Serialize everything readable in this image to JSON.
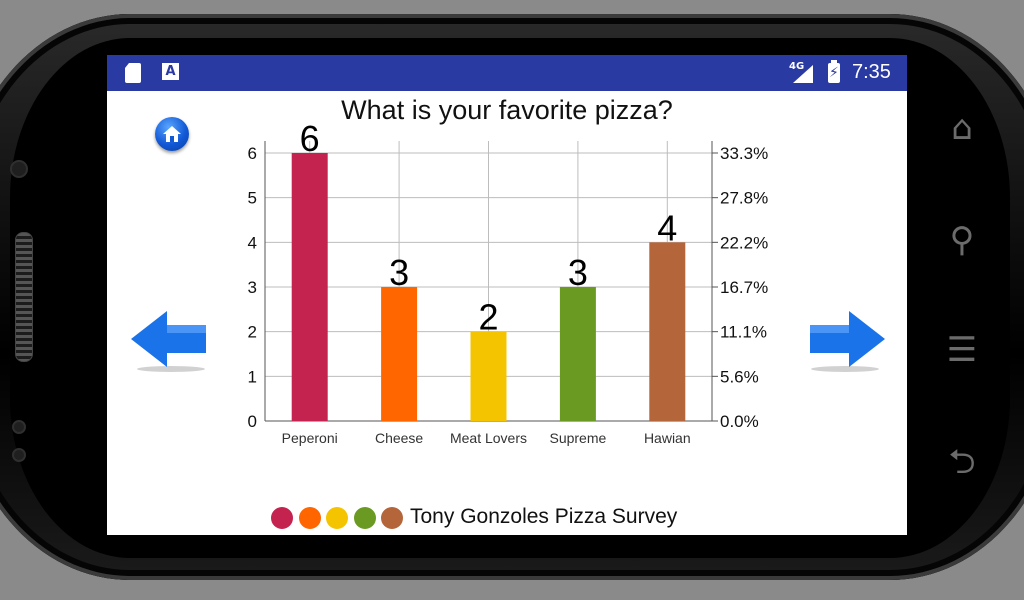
{
  "statusbar": {
    "network": "4G",
    "time": "7:35",
    "icons": [
      "sd-card-icon",
      "a-notification-icon",
      "signal-icon",
      "battery-charging-icon"
    ]
  },
  "app": {
    "title": "What is your favorite pizza?",
    "legend_text": "Tony Gonzoles Pizza Survey"
  },
  "navigation": {
    "home": "home-icon",
    "previous": "arrow-left-icon",
    "next": "arrow-right-icon"
  },
  "colors": {
    "statusbar": "#2a3aa3",
    "arrow": "#1a73e8"
  },
  "chart_data": {
    "type": "bar",
    "categories": [
      "Peperoni",
      "Cheese",
      "Meat Lovers",
      "Supreme",
      "Hawian"
    ],
    "values": [
      6,
      3,
      2,
      3,
      4
    ],
    "colors": [
      "#c5234f",
      "#ff6600",
      "#f5c400",
      "#6a9a22",
      "#b5653a"
    ],
    "ylim": [
      0,
      6
    ],
    "y_ticks": [
      "0",
      "1",
      "2",
      "3",
      "4",
      "5",
      "6"
    ],
    "y2_ticks": [
      "0.0%",
      "5.6%",
      "11.1%",
      "16.7%",
      "22.2%",
      "27.8%",
      "33.3%"
    ],
    "grid": true,
    "data_labels": true,
    "legend_position": "bottom"
  }
}
